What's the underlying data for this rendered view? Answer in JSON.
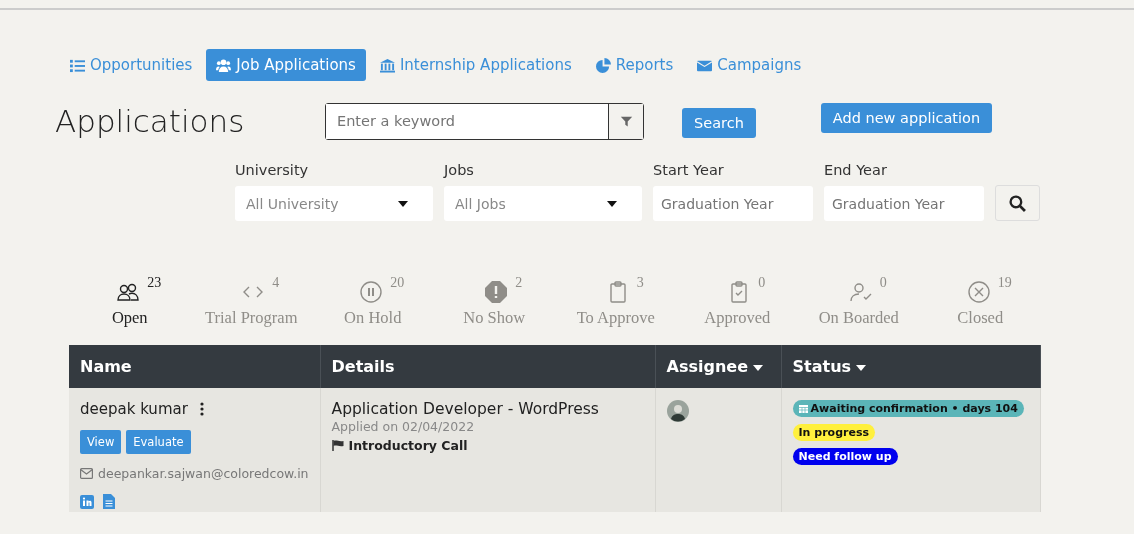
{
  "nav": [
    {
      "label": "Opportunities",
      "kind": "list",
      "selected": false
    },
    {
      "label": "Job Applications",
      "kind": "users",
      "selected": true
    },
    {
      "label": "Internship Applications",
      "kind": "bank",
      "selected": false
    },
    {
      "label": "Reports",
      "kind": "pie",
      "selected": false
    },
    {
      "label": "Campaigns",
      "kind": "mail",
      "selected": false
    }
  ],
  "title": "Applications",
  "search": {
    "placeholder": "Enter a keyword",
    "button": "Search"
  },
  "add_button": "Add new application",
  "filters": [
    {
      "label": "University",
      "kind": "select",
      "value": "All University"
    },
    {
      "label": "Jobs",
      "kind": "select",
      "value": "All Jobs"
    },
    {
      "label": "Start Year",
      "kind": "input",
      "placeholder": "Graduation Year"
    },
    {
      "label": "End Year",
      "kind": "input",
      "placeholder": "Graduation Year"
    }
  ],
  "status_tabs": [
    {
      "label": "Open",
      "count": "23",
      "kind": "users",
      "selected": true
    },
    {
      "label": "Trial Program",
      "count": "4",
      "kind": "code",
      "selected": false
    },
    {
      "label": "On Hold",
      "count": "20",
      "kind": "pause",
      "selected": false
    },
    {
      "label": "No Show",
      "count": "2",
      "kind": "alert",
      "selected": false
    },
    {
      "label": "To Approve",
      "count": "3",
      "kind": "clipboard",
      "selected": false
    },
    {
      "label": "Approved",
      "count": "0",
      "kind": "clipcheck",
      "selected": false
    },
    {
      "label": "On Boarded",
      "count": "0",
      "kind": "usercheck",
      "selected": false
    },
    {
      "label": "Closed",
      "count": "19",
      "kind": "xcircle",
      "selected": false
    }
  ],
  "table": {
    "columns": [
      {
        "label": "Name",
        "dropdown": false
      },
      {
        "label": "Details",
        "dropdown": false
      },
      {
        "label": "Assignee",
        "dropdown": true
      },
      {
        "label": "Status",
        "dropdown": true
      }
    ],
    "rows": [
      {
        "name": "deepak kumar",
        "actions": [
          "View",
          "Evaluate"
        ],
        "email": "deepankar.sajwan@coloredcow.in",
        "job": "Application Developer - WordPress",
        "applied": "Applied on 02/04/2022",
        "stage": "Introductory Call",
        "tags": [
          {
            "text": "Awaiting confirmation • days 104",
            "color": "#5bb5b8",
            "icon": true
          },
          {
            "text": "In progress",
            "color": "#fff03d",
            "icon": false
          },
          {
            "text": "Need follow up",
            "color": "#0000ee",
            "icon": false
          }
        ]
      }
    ]
  }
}
